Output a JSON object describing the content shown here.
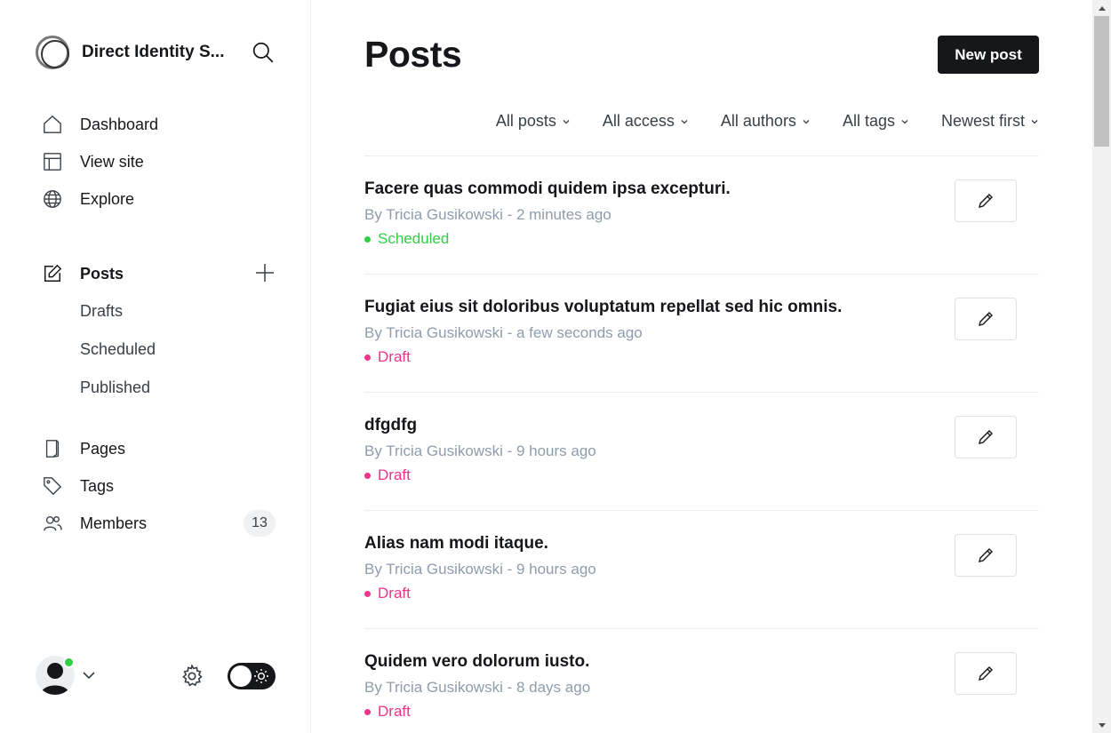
{
  "sidebar": {
    "brand_name": "Direct Identity S...",
    "nav": [
      {
        "label": "Dashboard",
        "icon": "home-icon"
      },
      {
        "label": "View site",
        "icon": "layout-icon"
      },
      {
        "label": "Explore",
        "icon": "globe-icon"
      }
    ],
    "posts_label": "Posts",
    "post_subs": [
      "Drafts",
      "Scheduled",
      "Published"
    ],
    "nav2": [
      {
        "label": "Pages",
        "icon": "pages-icon"
      },
      {
        "label": "Tags",
        "icon": "tag-icon"
      },
      {
        "label": "Members",
        "icon": "members-icon"
      }
    ],
    "members_count": "13"
  },
  "main": {
    "title": "Posts",
    "new_post_label": "New post",
    "filters": [
      "All posts",
      "All access",
      "All authors",
      "All tags",
      "Newest first"
    ],
    "posts": [
      {
        "title": "Facere quas commodi quidem ipsa excepturi.",
        "meta": "By Tricia Gusikowski - 2 minutes ago",
        "status": "Scheduled"
      },
      {
        "title": "Fugiat eius sit doloribus voluptatum repellat sed hic omnis.",
        "meta": "By Tricia Gusikowski - a few seconds ago",
        "status": "Draft"
      },
      {
        "title": "dfgdfg",
        "meta": "By Tricia Gusikowski - 9 hours ago",
        "status": "Draft"
      },
      {
        "title": "Alias nam modi itaque.",
        "meta": "By Tricia Gusikowski - 9 hours ago",
        "status": "Draft"
      },
      {
        "title": "Quidem vero dolorum iusto.",
        "meta": "By Tricia Gusikowski - 8 days ago",
        "status": "Draft"
      }
    ]
  },
  "colors": {
    "scheduled": "#30cf43",
    "draft": "#f0338a",
    "primary_button": "#15171a",
    "muted_text": "#8e9cac"
  }
}
